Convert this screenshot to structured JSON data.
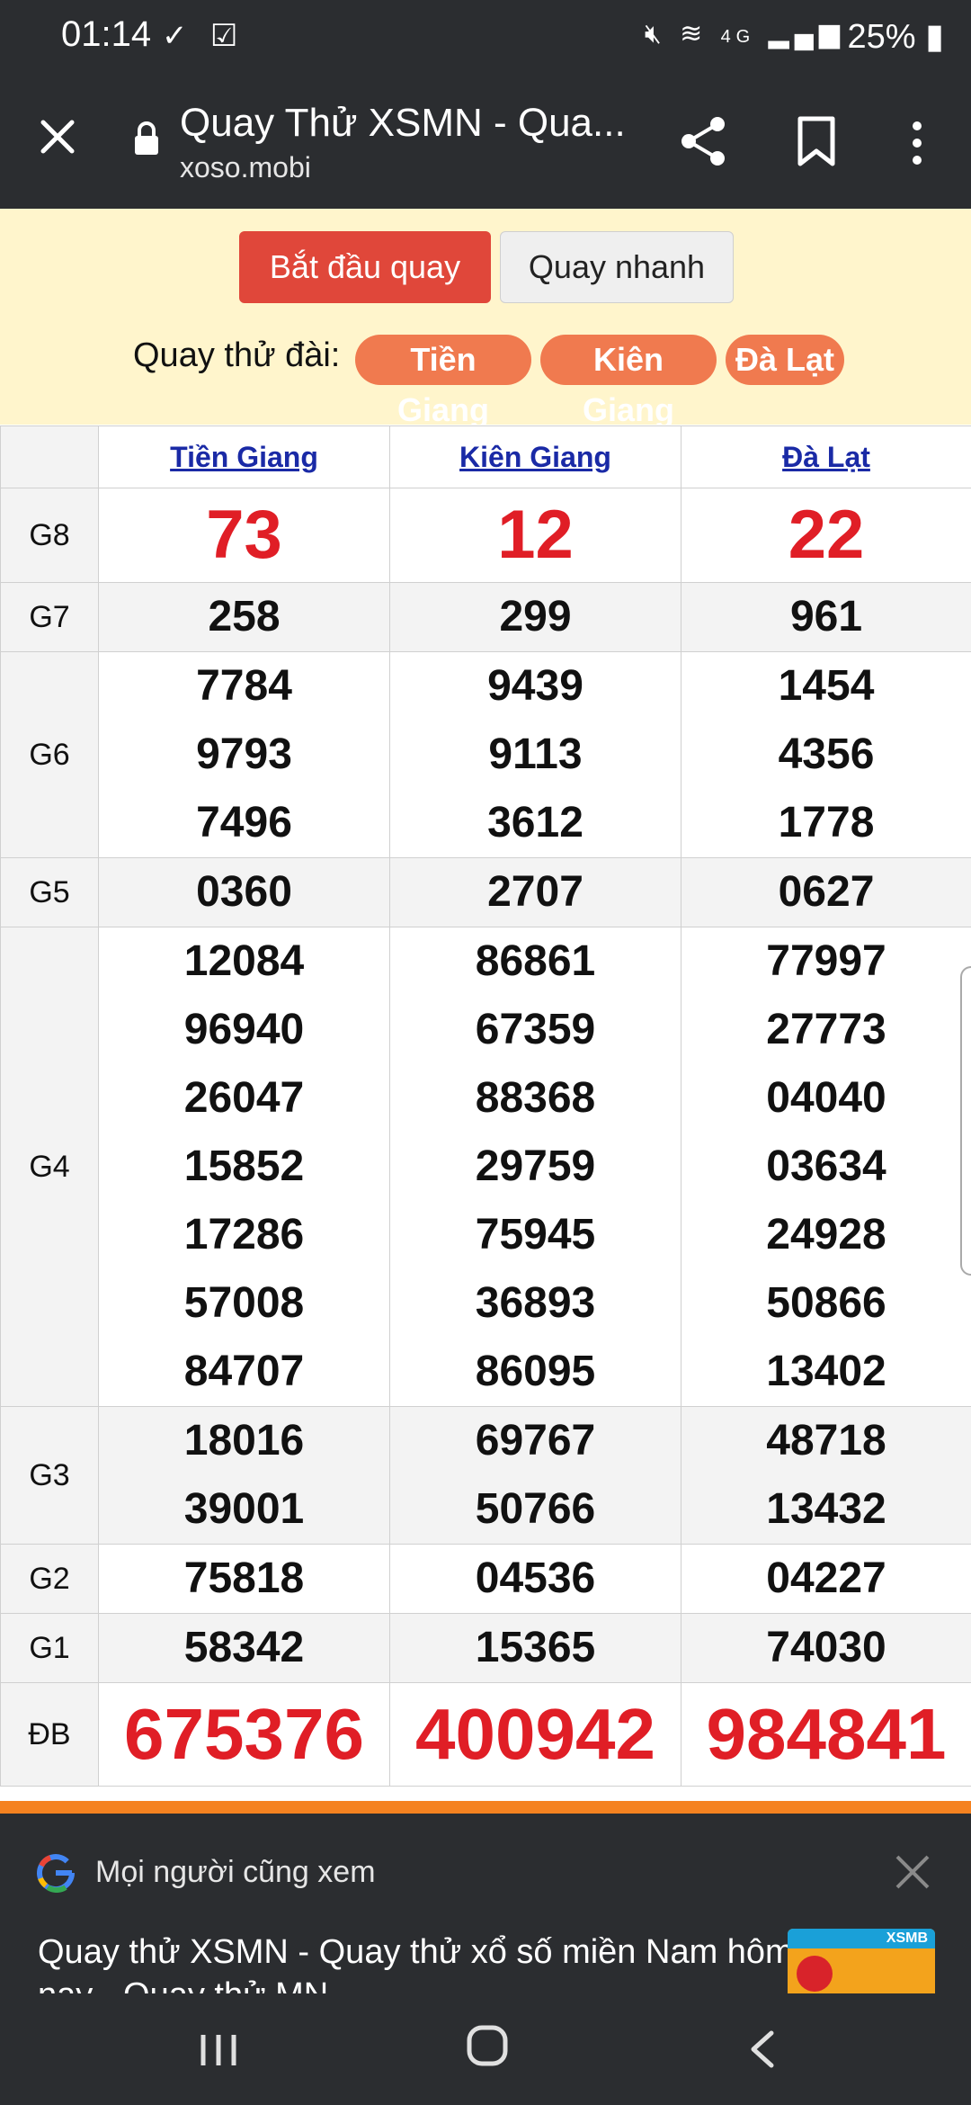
{
  "status": {
    "time": "01:14",
    "battery": "25%",
    "network": "4G"
  },
  "toolbar": {
    "title": "Quay Thử XSMN - Qua...",
    "domain": "xoso.mobi"
  },
  "controls": {
    "start_label": "Bắt đầu quay",
    "fast_label": "Quay nhanh",
    "station_label": "Quay thử đài:",
    "stations": [
      "Tiền Giang",
      "Kiên Giang",
      "Đà Lạt"
    ]
  },
  "table": {
    "provinces": [
      "Tiền Giang",
      "Kiên Giang",
      "Đà Lạt"
    ],
    "prizes": {
      "g8": {
        "label": "G8",
        "values": [
          [
            "73"
          ],
          [
            "12"
          ],
          [
            "22"
          ]
        ]
      },
      "g7": {
        "label": "G7",
        "values": [
          [
            "258"
          ],
          [
            "299"
          ],
          [
            "961"
          ]
        ]
      },
      "g6": {
        "label": "G6",
        "values": [
          [
            "7784",
            "9793",
            "7496"
          ],
          [
            "9439",
            "9113",
            "3612"
          ],
          [
            "1454",
            "4356",
            "1778"
          ]
        ]
      },
      "g5": {
        "label": "G5",
        "values": [
          [
            "0360"
          ],
          [
            "2707"
          ],
          [
            "0627"
          ]
        ]
      },
      "g4": {
        "label": "G4",
        "values": [
          [
            "12084",
            "96940",
            "26047",
            "15852",
            "17286",
            "57008",
            "84707"
          ],
          [
            "86861",
            "67359",
            "88368",
            "29759",
            "75945",
            "36893",
            "86095"
          ],
          [
            "77997",
            "27773",
            "04040",
            "03634",
            "24928",
            "50866",
            "13402"
          ]
        ]
      },
      "g3": {
        "label": "G3",
        "values": [
          [
            "18016",
            "39001"
          ],
          [
            "69767",
            "50766"
          ],
          [
            "48718",
            "13432"
          ]
        ]
      },
      "g2": {
        "label": "G2",
        "values": [
          [
            "75818"
          ],
          [
            "04536"
          ],
          [
            "04227"
          ]
        ]
      },
      "g1": {
        "label": "G1",
        "values": [
          [
            "58342"
          ],
          [
            "15365"
          ],
          [
            "74030"
          ]
        ]
      },
      "db": {
        "label": "ĐB",
        "values": [
          [
            "675376"
          ],
          [
            "400942"
          ],
          [
            "984841"
          ]
        ]
      }
    }
  },
  "sheet": {
    "header": "Mọi người cũng xem",
    "title": "Quay thử XSMN - Quay thử xổ số miền Nam hôm nay - Quay thử MN",
    "thumb_text": "XSMB"
  },
  "colors": {
    "chrome": "#2b2d30",
    "panel": "#fff5cc",
    "start_button": "#e0473a",
    "pill": "#f07a4f",
    "highlight_red": "#e01e26",
    "link": "#1a2aa6",
    "divider": "#f58220"
  }
}
